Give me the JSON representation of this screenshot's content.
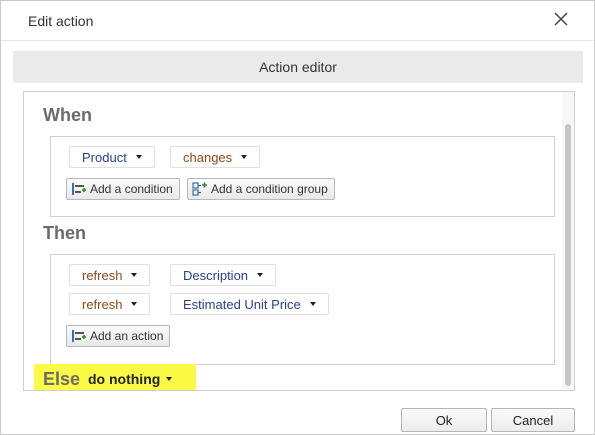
{
  "dialog": {
    "title": "Edit action",
    "close_icon": "close-icon"
  },
  "editor": {
    "header": "Action editor",
    "when": {
      "heading": "When",
      "field": "Product",
      "operator": "changes",
      "add_condition_label": "Add a condition",
      "add_condition_group_label": "Add a condition group"
    },
    "then": {
      "heading": "Then",
      "actions": [
        {
          "verb": "refresh",
          "target": "Description"
        },
        {
          "verb": "refresh",
          "target": "Estimated Unit Price"
        }
      ],
      "add_action_label": "Add an action"
    },
    "else": {
      "heading": "Else",
      "value": "do nothing",
      "highlight_color": "#fbfa45"
    }
  },
  "footer": {
    "ok_label": "Ok",
    "cancel_label": "Cancel"
  }
}
